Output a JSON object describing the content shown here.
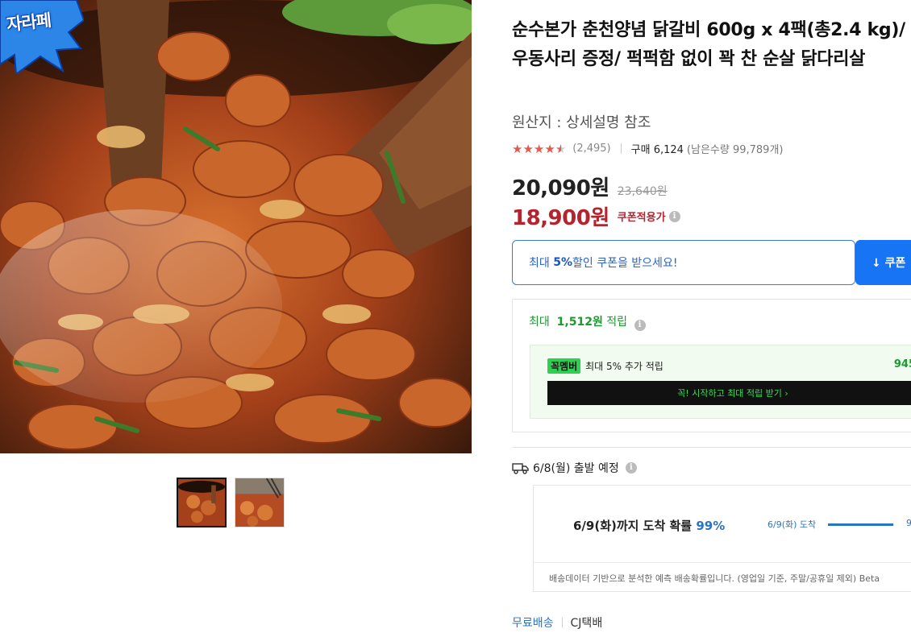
{
  "badge": {
    "text": "자라페"
  },
  "gallery": {
    "thumbnails": [
      "thumb-1",
      "thumb-2"
    ],
    "active_index": 0
  },
  "product": {
    "title": "순수본가 춘천양념 닭갈비 600g x 4팩(총2.4 kg)/ 우동사리 증정/ 퍽퍽함 없이 꽉 찬 순살 닭다리살",
    "origin": "원산지 : 상세설명 참조",
    "rating": 4.5,
    "review_count": "(2,495)",
    "purchase_count": "구매 6,124",
    "remaining": "(남은수량 99,789개)"
  },
  "price": {
    "sale": "20,090원",
    "original": "23,640원",
    "coupon_price": "18,900원",
    "coupon_label": "쿠폰적용가"
  },
  "coupon": {
    "prefix": "최대 ",
    "highlight": "5%",
    "suffix": " 할인 쿠폰을 받으세요!",
    "button_label": "↓ 쿠폰"
  },
  "points": {
    "prefix": "최대 ",
    "amount": "1,512원",
    "suffix": " 적립",
    "member_logo": "꼭멤버",
    "member_text": "최대 5% 추가 적립",
    "member_amount": "945",
    "member_button": "꼭! 시작하고 최대 적립 받기 ›"
  },
  "shipping": {
    "depart": "6/8(월) 출발 예정",
    "arrive_prefix": "6/9(화)까지 도착 확률 ",
    "arrive_pct": "99%",
    "bar_label": "6/9(화) 도착",
    "bar_fill": 0.99,
    "bar_pct": "9",
    "note": "배송데이터 기반으로 분석한 예측 배송확률입니다. (영업일 기준, 주말/공휴일 제외) Beta",
    "free": "무료배송",
    "courier": "CJ택배"
  },
  "colors": {
    "accent_blue": "#1774f5",
    "price_red": "#b3242f",
    "member_green": "#1a9b2e",
    "star": "#e25a4d"
  }
}
